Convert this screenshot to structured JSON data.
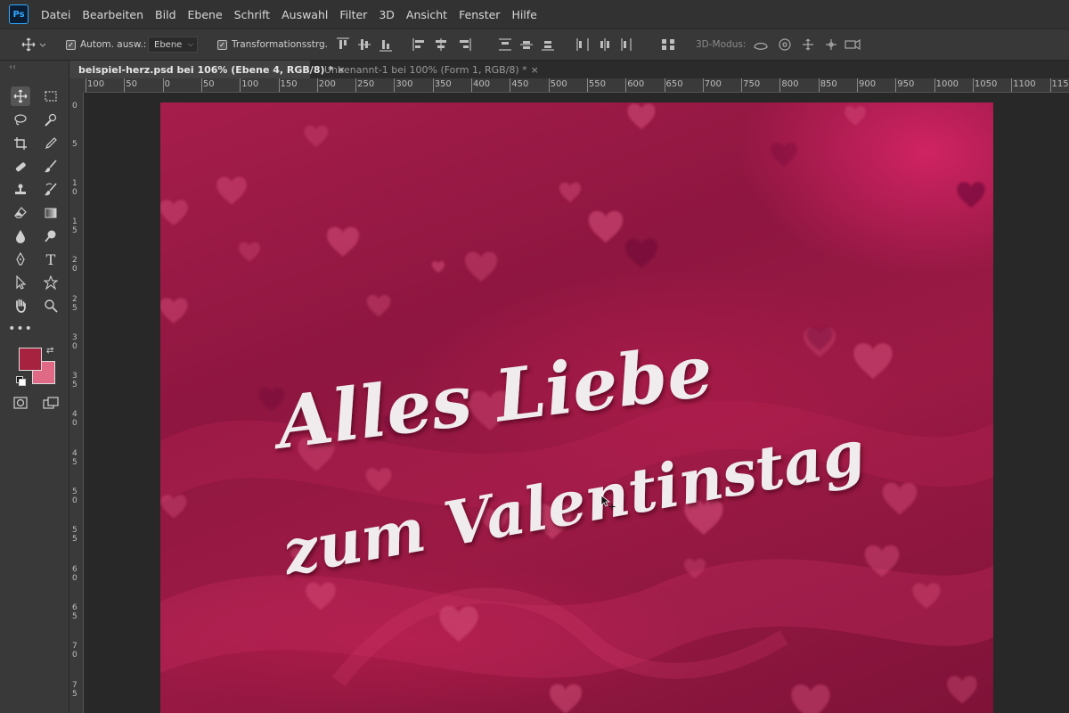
{
  "app": {
    "logo": "Ps"
  },
  "menu": [
    "Datei",
    "Bearbeiten",
    "Bild",
    "Ebene",
    "Schrift",
    "Auswahl",
    "Filter",
    "3D",
    "Ansicht",
    "Fenster",
    "Hilfe"
  ],
  "options_bar": {
    "auto_select_label": "Autom. ausw.:",
    "auto_select_checked": true,
    "auto_select_target": "Ebene",
    "transform_label": "Transformationsstrg.",
    "transform_checked": true,
    "mode_3d_label": "3D-Modus:"
  },
  "tabs": [
    {
      "label": "beispiel-herz.psd bei 106% (Ebene 4, RGB/8) *",
      "close": "×",
      "active": true
    },
    {
      "label": "Unbenannt-1 bei 100% (Form 1, RGB/8) *",
      "close": "×",
      "active": false
    }
  ],
  "rulers": {
    "horizontal": [
      "100",
      "50",
      "0",
      "50",
      "100",
      "150",
      "200",
      "250",
      "300",
      "350",
      "400",
      "450",
      "500",
      "550",
      "600",
      "650",
      "700",
      "750",
      "800",
      "850",
      "900",
      "950",
      "1000",
      "1050",
      "1100",
      "1150"
    ],
    "vertical": [
      "0",
      "5",
      "1 0",
      "1 5",
      "2 0",
      "2 5",
      "3 0",
      "3 5",
      "4 0",
      "4 5",
      "5 0",
      "5 5",
      "6 0",
      "6 5",
      "7 0",
      "7 5"
    ]
  },
  "colors": {
    "foreground": "#a6223f",
    "background": "#e06a86",
    "canvas_base": "#9b1a45",
    "text": "#f0ecee"
  },
  "canvas_text": {
    "line1": "Alles Liebe",
    "line2": "zum Valentinstag"
  },
  "icons": [
    "move-icon",
    "marquee-icon",
    "lasso-icon",
    "quick-select-icon",
    "crop-icon",
    "eyedropper-icon",
    "healing-icon",
    "brush-icon",
    "stamp-icon",
    "history-brush-icon",
    "eraser-icon",
    "gradient-icon",
    "blur-icon",
    "dodge-icon",
    "pen-icon",
    "type-icon",
    "path-select-icon",
    "shape-icon",
    "hand-icon",
    "zoom-icon",
    "more-tools-icon",
    "swap-colors-icon",
    "default-colors-icon",
    "quick-mask-icon",
    "screen-mode-icon"
  ]
}
